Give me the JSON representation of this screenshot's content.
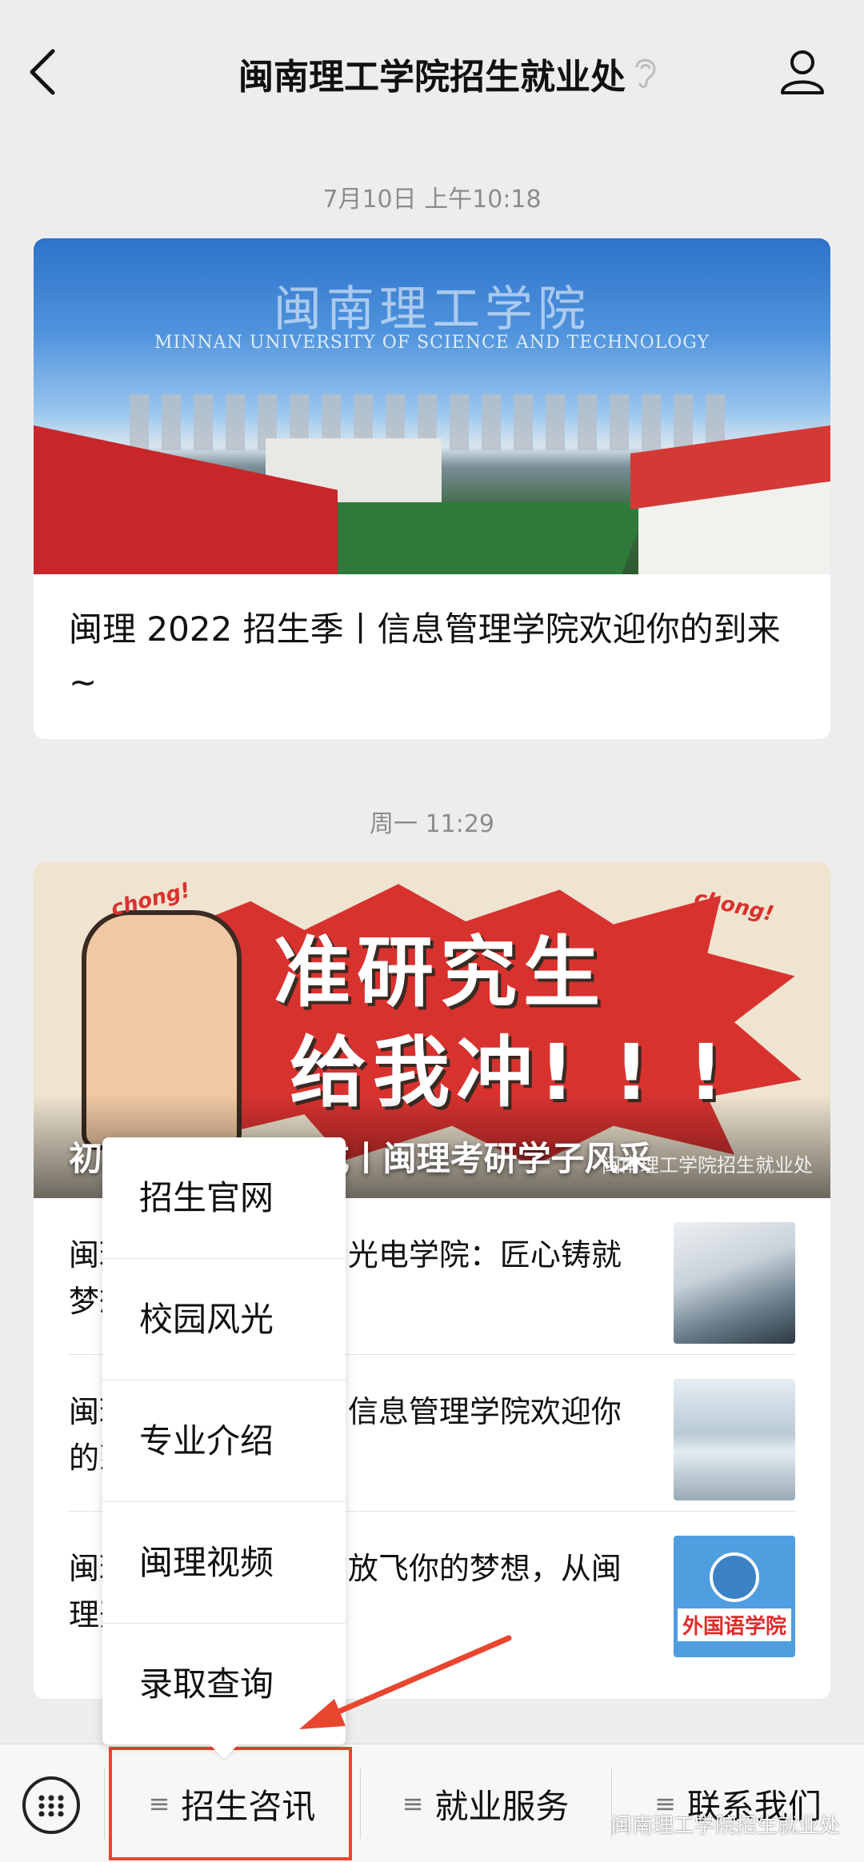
{
  "header": {
    "title": "闽南理工学院招生就业处"
  },
  "messages": [
    {
      "time": "7月10日 上午10:18",
      "banner": {
        "cn": "闽南理工学院",
        "en": "MINNAN UNIVERSITY OF SCIENCE AND TECHNOLOGY"
      },
      "title": "闽理 2022 招生季丨信息管理学院欢迎你的到来~"
    },
    {
      "time": "周一 11:29",
      "banner": {
        "line1": "准研究生",
        "line2": "给我冲! ! !",
        "chong": "chong!",
        "overlay": "初心未负 梦想终成丨闽理考研学子风采",
        "watermark": "闽南理工学院招生就业处"
      },
      "list": [
        {
          "text": "闽理 2022 招生季丨光电学院：匠心铸就梦想，未来可期"
        },
        {
          "text": "闽理 2022 招生季丨信息管理学院欢迎你的到来~"
        },
        {
          "text": "闽理 2022 招生季丨放飞你的梦想，从闽理开始"
        }
      ],
      "thumb3_label": "外国语学院"
    }
  ],
  "popup_menu": {
    "items": [
      "招生官网",
      "校园风光",
      "专业介绍",
      "闽理视频",
      "录取查询"
    ]
  },
  "bottom_bar": {
    "tabs": [
      "招生咨讯",
      "就业服务",
      "联系我们"
    ],
    "hamburger": "≡"
  },
  "watermark": "闽南理工学院招生就业处",
  "colors": {
    "highlight": "#e8462f",
    "background": "#ededed"
  }
}
